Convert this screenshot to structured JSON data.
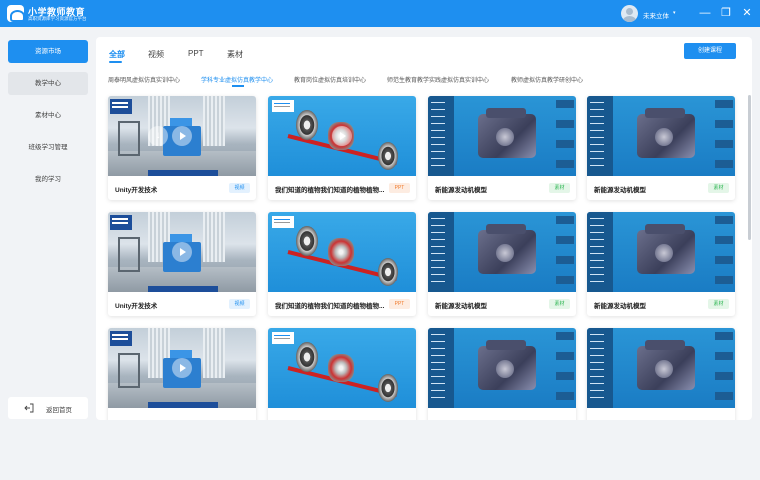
{
  "app": {
    "name": "小学教师教育",
    "subtitle": "高职资源库学习资源官方平台"
  },
  "user": {
    "name": "未来立体",
    "caret": "▾"
  },
  "window": {
    "minimize": "—",
    "maximize": "❐",
    "close": "✕"
  },
  "sidebar": {
    "items": [
      {
        "label": "资源市场"
      },
      {
        "label": "教学中心"
      },
      {
        "label": "素材中心"
      },
      {
        "label": "班级学习管理"
      },
      {
        "label": "我的学习"
      }
    ],
    "back_label": "返回首页"
  },
  "tabs": [
    {
      "label": "全部"
    },
    {
      "label": "视频"
    },
    {
      "label": "PPT"
    },
    {
      "label": "素材"
    }
  ],
  "create_button": "创建课程",
  "subcategories": [
    {
      "label": "周泰明风虚拟仿真实训中心"
    },
    {
      "label": "学科专业虚拟仿真教学中心"
    },
    {
      "label": "教育岗位虚拟仿真培训中心"
    },
    {
      "label": "师范生教育教学实践虚拟仿真实训中心"
    },
    {
      "label": "教师虚拟仿真教学研创中心"
    }
  ],
  "cards": [
    {
      "title": "Unity开发技术",
      "tag": "视频"
    },
    {
      "title": "我们知道的植物我们知道的植物植物...",
      "tag": "PPT"
    },
    {
      "title": "新能源发动机模型",
      "tag": "素材"
    },
    {
      "title": "新能源发动机模型",
      "tag": "素材"
    },
    {
      "title": "Unity开发技术",
      "tag": "视频"
    },
    {
      "title": "我们知道的植物我们知道的植物植物...",
      "tag": "PPT"
    },
    {
      "title": "新能源发动机模型",
      "tag": "素材"
    },
    {
      "title": "新能源发动机模型",
      "tag": "素材"
    },
    {
      "title": "",
      "tag": ""
    },
    {
      "title": "",
      "tag": ""
    },
    {
      "title": "",
      "tag": ""
    },
    {
      "title": "",
      "tag": ""
    }
  ],
  "colors": {
    "accent": "#1e8ff0",
    "tag_video": "#1e8ff0",
    "tag_ppt": "#f07a2b",
    "tag_material": "#2db552"
  }
}
